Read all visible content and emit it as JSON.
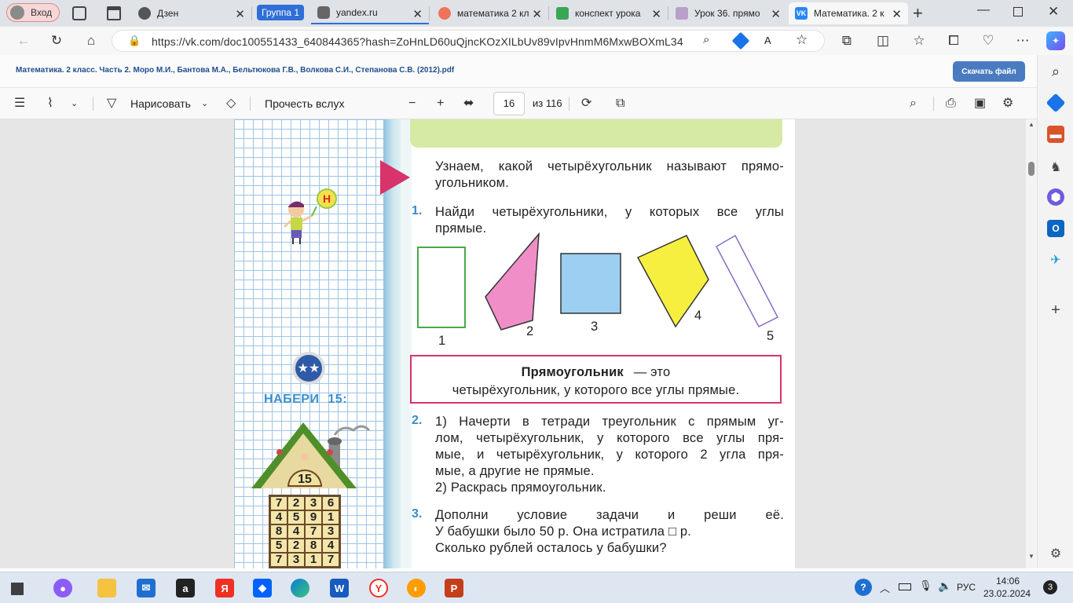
{
  "browser": {
    "profile_label": "Вход",
    "tabs": [
      {
        "label": "Дзен",
        "fav": "#555"
      },
      {
        "label": "Группа 1",
        "is_group": true
      },
      {
        "label": "yandex.ru",
        "fav": "#666"
      },
      {
        "label": "математика 2 кл",
        "fav": "#f0735c"
      },
      {
        "label": "конспект урока",
        "fav": "#3aa755"
      },
      {
        "label": "Урок 36. прямо",
        "fav": "#b9a0c9"
      },
      {
        "label": "Математика. 2 к",
        "fav": "#2787f5"
      }
    ],
    "url": "https://vk.com/doc100551433_640844365?hash=ZoHnLD60uQjncKOzXILbUv89vIpvHnmM6MxwBOXmL34"
  },
  "pdf": {
    "title": "Математика. 2 класс. Часть 2. Моро М.И., Бантова М.А., Бельтюкова Г.В., Волкова С.И., Степанова С.В. (2012).pdf",
    "download_label": "Скачать файл",
    "toolbar": {
      "draw_label": "Нарисовать",
      "read_aloud_label": "Прочесть вслух",
      "page_current": "16",
      "page_total": "из 116"
    }
  },
  "page": {
    "intro_line1": "Узнаем, какой четырёхугольник называют прямо-",
    "intro_line2": "угольником.",
    "task1_num": "1.",
    "task1_line1": "Найди четырёхугольники, у которых все углы",
    "task1_line2": "прямые.",
    "shape_labels": [
      "1",
      "2",
      "3",
      "4",
      "5"
    ],
    "definition_term": "Прямоугольник",
    "definition_rest": "— это",
    "definition_line2": "четырёхугольник, у которого все углы прямые.",
    "task2_num": "2.",
    "task2_lines": [
      "1) Начерти в тетради треугольник с прямым уг-",
      "лом, четырёхугольник, у которого все углы пря-",
      "мые, и четырёхугольник, у которого 2 угла пря-",
      "мые, а другие не прямые.",
      "2) Раскрась прямоугольник."
    ],
    "task3_num": "3.",
    "task3_lines": [
      "Дополни условие задачи и реши её.",
      "У бабушки было 50 р. Она истратила □ р.",
      "Сколько рублей осталось у бабушки?"
    ],
    "new_badge": "Н",
    "naberi_label": "НАБЕРИ",
    "naberi_number": "15:",
    "house_roof_number": "15",
    "house_rows": [
      [
        "7",
        "2",
        "3",
        "6"
      ],
      [
        "4",
        "5",
        "9",
        "1"
      ],
      [
        "8",
        "4",
        "7",
        "3"
      ],
      [
        "5",
        "2",
        "8",
        "4"
      ],
      [
        "7",
        "3",
        "1",
        "7"
      ]
    ]
  },
  "taskbar": {
    "lang": "РУС",
    "time": "14:06",
    "date": "23.02.2024",
    "notifications": "3"
  }
}
